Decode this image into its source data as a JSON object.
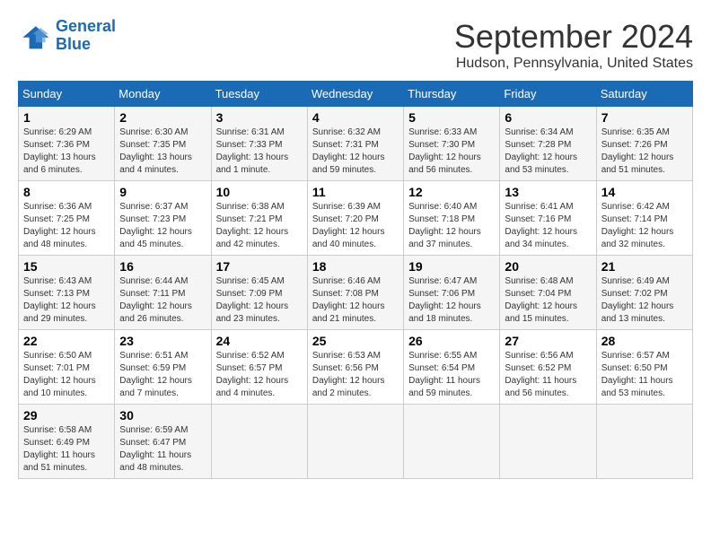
{
  "logo": {
    "text_general": "General",
    "text_blue": "Blue"
  },
  "title": "September 2024",
  "subtitle": "Hudson, Pennsylvania, United States",
  "headers": [
    "Sunday",
    "Monday",
    "Tuesday",
    "Wednesday",
    "Thursday",
    "Friday",
    "Saturday"
  ],
  "weeks": [
    [
      {
        "day": "1",
        "info": "Sunrise: 6:29 AM\nSunset: 7:36 PM\nDaylight: 13 hours and 6 minutes."
      },
      {
        "day": "2",
        "info": "Sunrise: 6:30 AM\nSunset: 7:35 PM\nDaylight: 13 hours and 4 minutes."
      },
      {
        "day": "3",
        "info": "Sunrise: 6:31 AM\nSunset: 7:33 PM\nDaylight: 13 hours and 1 minute."
      },
      {
        "day": "4",
        "info": "Sunrise: 6:32 AM\nSunset: 7:31 PM\nDaylight: 12 hours and 59 minutes."
      },
      {
        "day": "5",
        "info": "Sunrise: 6:33 AM\nSunset: 7:30 PM\nDaylight: 12 hours and 56 minutes."
      },
      {
        "day": "6",
        "info": "Sunrise: 6:34 AM\nSunset: 7:28 PM\nDaylight: 12 hours and 53 minutes."
      },
      {
        "day": "7",
        "info": "Sunrise: 6:35 AM\nSunset: 7:26 PM\nDaylight: 12 hours and 51 minutes."
      }
    ],
    [
      {
        "day": "8",
        "info": "Sunrise: 6:36 AM\nSunset: 7:25 PM\nDaylight: 12 hours and 48 minutes."
      },
      {
        "day": "9",
        "info": "Sunrise: 6:37 AM\nSunset: 7:23 PM\nDaylight: 12 hours and 45 minutes."
      },
      {
        "day": "10",
        "info": "Sunrise: 6:38 AM\nSunset: 7:21 PM\nDaylight: 12 hours and 42 minutes."
      },
      {
        "day": "11",
        "info": "Sunrise: 6:39 AM\nSunset: 7:20 PM\nDaylight: 12 hours and 40 minutes."
      },
      {
        "day": "12",
        "info": "Sunrise: 6:40 AM\nSunset: 7:18 PM\nDaylight: 12 hours and 37 minutes."
      },
      {
        "day": "13",
        "info": "Sunrise: 6:41 AM\nSunset: 7:16 PM\nDaylight: 12 hours and 34 minutes."
      },
      {
        "day": "14",
        "info": "Sunrise: 6:42 AM\nSunset: 7:14 PM\nDaylight: 12 hours and 32 minutes."
      }
    ],
    [
      {
        "day": "15",
        "info": "Sunrise: 6:43 AM\nSunset: 7:13 PM\nDaylight: 12 hours and 29 minutes."
      },
      {
        "day": "16",
        "info": "Sunrise: 6:44 AM\nSunset: 7:11 PM\nDaylight: 12 hours and 26 minutes."
      },
      {
        "day": "17",
        "info": "Sunrise: 6:45 AM\nSunset: 7:09 PM\nDaylight: 12 hours and 23 minutes."
      },
      {
        "day": "18",
        "info": "Sunrise: 6:46 AM\nSunset: 7:08 PM\nDaylight: 12 hours and 21 minutes."
      },
      {
        "day": "19",
        "info": "Sunrise: 6:47 AM\nSunset: 7:06 PM\nDaylight: 12 hours and 18 minutes."
      },
      {
        "day": "20",
        "info": "Sunrise: 6:48 AM\nSunset: 7:04 PM\nDaylight: 12 hours and 15 minutes."
      },
      {
        "day": "21",
        "info": "Sunrise: 6:49 AM\nSunset: 7:02 PM\nDaylight: 12 hours and 13 minutes."
      }
    ],
    [
      {
        "day": "22",
        "info": "Sunrise: 6:50 AM\nSunset: 7:01 PM\nDaylight: 12 hours and 10 minutes."
      },
      {
        "day": "23",
        "info": "Sunrise: 6:51 AM\nSunset: 6:59 PM\nDaylight: 12 hours and 7 minutes."
      },
      {
        "day": "24",
        "info": "Sunrise: 6:52 AM\nSunset: 6:57 PM\nDaylight: 12 hours and 4 minutes."
      },
      {
        "day": "25",
        "info": "Sunrise: 6:53 AM\nSunset: 6:56 PM\nDaylight: 12 hours and 2 minutes."
      },
      {
        "day": "26",
        "info": "Sunrise: 6:55 AM\nSunset: 6:54 PM\nDaylight: 11 hours and 59 minutes."
      },
      {
        "day": "27",
        "info": "Sunrise: 6:56 AM\nSunset: 6:52 PM\nDaylight: 11 hours and 56 minutes."
      },
      {
        "day": "28",
        "info": "Sunrise: 6:57 AM\nSunset: 6:50 PM\nDaylight: 11 hours and 53 minutes."
      }
    ],
    [
      {
        "day": "29",
        "info": "Sunrise: 6:58 AM\nSunset: 6:49 PM\nDaylight: 11 hours and 51 minutes."
      },
      {
        "day": "30",
        "info": "Sunrise: 6:59 AM\nSunset: 6:47 PM\nDaylight: 11 hours and 48 minutes."
      },
      {
        "day": "",
        "info": ""
      },
      {
        "day": "",
        "info": ""
      },
      {
        "day": "",
        "info": ""
      },
      {
        "day": "",
        "info": ""
      },
      {
        "day": "",
        "info": ""
      }
    ]
  ]
}
